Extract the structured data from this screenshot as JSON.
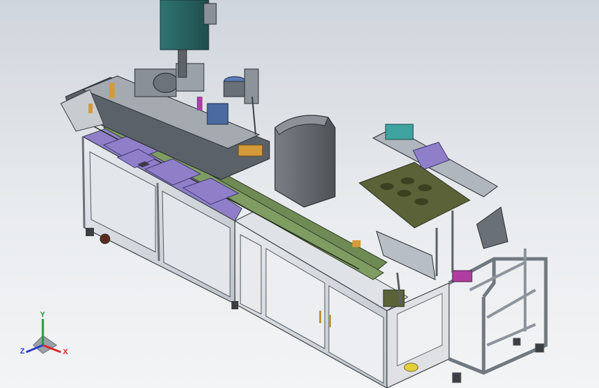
{
  "viewport": {
    "background_top": "#cfd5dc",
    "background_bottom": "#f3f4f5"
  },
  "colors": {
    "frame_aluminum": "#9aa2ab",
    "cabinet_panel": "#d9dde3",
    "cabinet_glass": "#e6e8ec",
    "plate_purple": "#8f7fc8",
    "rail_green": "#6f8a55",
    "machine_dark": "#5b6168",
    "motor_teal": "#2d6a6a",
    "cover_grey": "#6c7076",
    "accent_orange": "#d49a3a",
    "accent_magenta": "#b03ea0",
    "accent_yellow": "#e3cf3d"
  },
  "triad": {
    "x_label": "X",
    "y_label": "Y",
    "z_label": "Z",
    "x_color": "#d8262a",
    "y_color": "#1f9a35",
    "z_color": "#2a3bc4"
  }
}
